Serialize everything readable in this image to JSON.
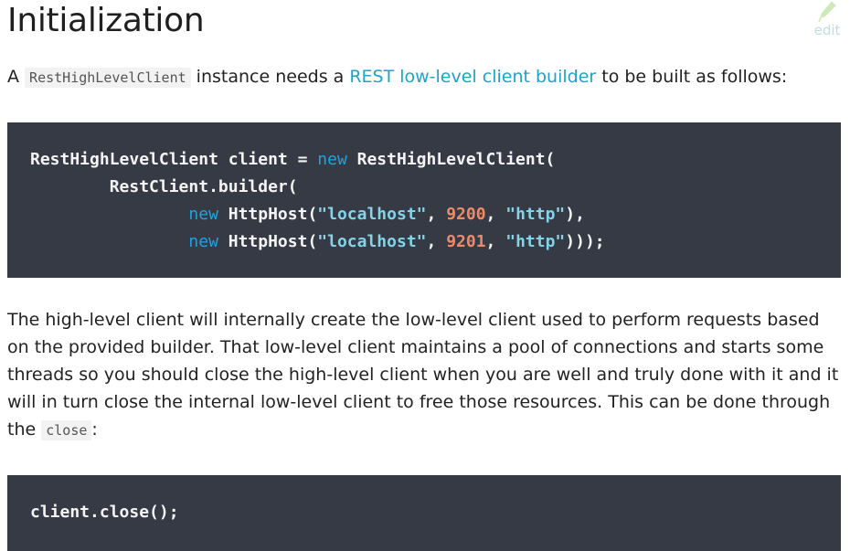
{
  "heading": "Initialization",
  "edit_label": "edit",
  "intro": {
    "prefix": "A ",
    "code": "RestHighLevelClient",
    "middle": " instance needs a ",
    "link": "REST low-level client builder",
    "suffix": " to be built as follows:"
  },
  "code_block_1": {
    "line1_a": "RestHighLevelClient client = ",
    "line1_kw": "new",
    "line1_b": " RestHighLevelClient(",
    "line2": "        RestClient.builder(",
    "line3_indent": "                ",
    "line3_kw": "new",
    "line3_a": " HttpHost(",
    "line3_str1": "\"localhost\"",
    "line3_sep1": ", ",
    "line3_num": "9200",
    "line3_sep2": ", ",
    "line3_str2": "\"http\"",
    "line3_end": "),",
    "line4_indent": "                ",
    "line4_kw": "new",
    "line4_a": " HttpHost(",
    "line4_str1": "\"localhost\"",
    "line4_sep1": ", ",
    "line4_num": "9201",
    "line4_sep2": ", ",
    "line4_str2": "\"http\"",
    "line4_end": ")));"
  },
  "para2": {
    "text": "The high-level client will internally create the low-level client used to perform requests based on the provided builder. That low-level client maintains a pool of connections and starts some threads so you should close the high-level client when you are well and truly done with it and it will in turn close the internal low-level client to free those resources. This can be done through the ",
    "code": "close",
    "suffix": ":"
  },
  "code_block_2": {
    "line1": "client.close();"
  }
}
